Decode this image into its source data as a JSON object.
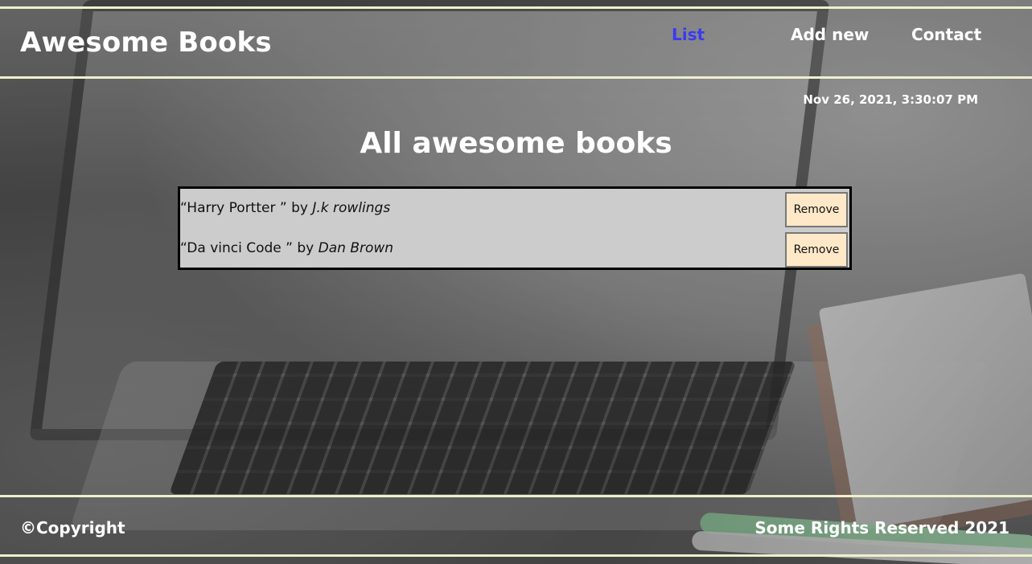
{
  "header": {
    "brand": "Awesome Books",
    "nav": {
      "list": "List",
      "add_new": "Add new",
      "contact": "Contact"
    }
  },
  "datetime": "Nov 26, 2021, 3:30:07 PM",
  "main": {
    "title": "All awesome books",
    "books": [
      {
        "title": "Harry Portter ",
        "by": "by",
        "author": "J.k rowlings",
        "remove_label": "Remove"
      },
      {
        "title": "Da vinci Code ",
        "by": "by",
        "author": "Dan Brown",
        "remove_label": "Remove"
      }
    ]
  },
  "footer": {
    "left": "©Copyright",
    "right": "Some Rights Reserved 2021"
  },
  "colors": {
    "active_nav": "#3a3af3",
    "frame_lines": "#eef0cc",
    "remove_button_bg": "#ffe8c8",
    "list_bg": "#cccccc"
  }
}
